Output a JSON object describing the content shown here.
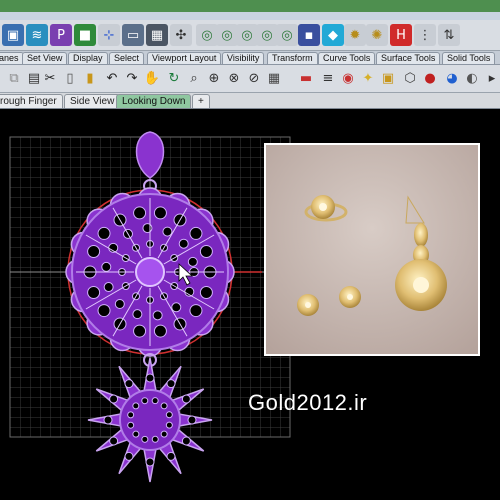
{
  "menu_tabs": [
    "lanes",
    "Set View",
    "Display",
    "Select",
    "Viewport Layout",
    "Visibility",
    "Transform",
    "Curve Tools",
    "Surface Tools",
    "Solid Tools"
  ],
  "viewport_tabs": [
    {
      "label": "rough Finger",
      "active": false
    },
    {
      "label": "Side View",
      "active": false
    },
    {
      "label": "Looking Down",
      "active": true
    }
  ],
  "add_viewport_tab_symbol": "+",
  "watermark": "Gold2012.ir",
  "colors": {
    "toolbar_bg": "#d9dde3",
    "active_tab": "#8fc7a0",
    "jewelry_purple": "#9b3fe0",
    "viewport_bg": "#000000",
    "grid": "#5a5a5a"
  },
  "toolbar_icons": [
    "cube-icon",
    "wave-icon",
    "parrot-icon",
    "green-square-icon",
    "axis-icon",
    "monitor-icon",
    "grid-icon",
    "puzzle-icon",
    "arrow-icon",
    "ring-icon",
    "ring-icon",
    "ring-icon",
    "ring-icon",
    "ring-icon",
    "ring-icon",
    "ring-icon",
    "ring-icon",
    "ring-icon",
    "ring-icon",
    "ring-icon",
    "ring-icon",
    "ring-icon",
    "ring-icon",
    "ring-icon",
    "save-icon",
    "gem-icon",
    "gear-icon",
    "gear-icon",
    "grid-icon",
    "red-h-icon"
  ]
}
